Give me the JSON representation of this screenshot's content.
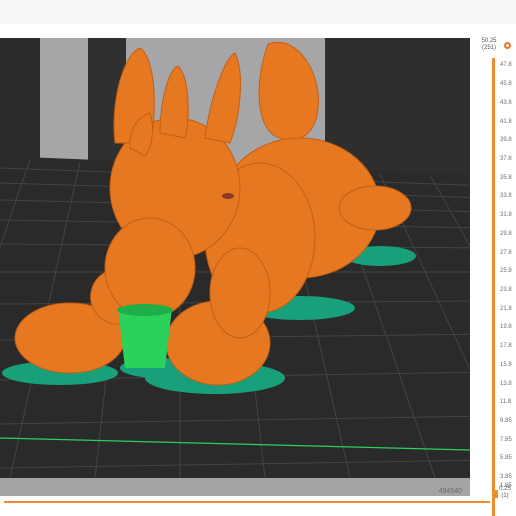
{
  "window": {
    "title": ""
  },
  "viewport": {
    "bed_color": "#2a2a2a",
    "grid_color": "#3d3d3d",
    "model_color": "#e67822",
    "support_color": "#2bd25a",
    "brim_color": "#17a07a",
    "h_slider_readout": "494540"
  },
  "layer_slider": {
    "top_value": "50.25",
    "top_layer": "(251)",
    "ticks": [
      "47.8",
      "45.8",
      "43.8",
      "41.8",
      "39.8",
      "37.8",
      "35.8",
      "33.8",
      "31.8",
      "29.8",
      "27.8",
      "25.8",
      "23.8",
      "21.8",
      "19.8",
      "17.8",
      "15.8",
      "13.8",
      "11.8",
      "9.85",
      "7.85",
      "5.85",
      "3.85",
      "1.85"
    ],
    "bottom_value": "0.25",
    "bottom_layer": "(1)"
  },
  "colors": {
    "accent": "#f08c2e"
  }
}
